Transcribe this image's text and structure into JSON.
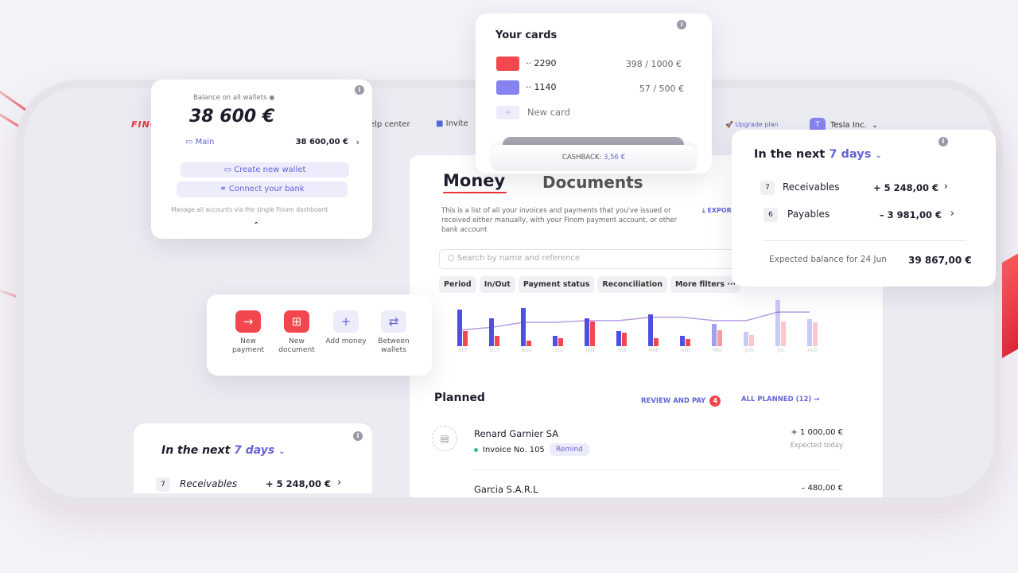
{
  "nav": {
    "logo": "FINOM",
    "help": "elp center",
    "invite": "Invite",
    "upgrade": "Upgrade plan",
    "company_initial": "T",
    "company": "Tesla Inc."
  },
  "balance": {
    "label": "Balance on all wallets",
    "amount": "38 600 €",
    "wallet_name": "Main",
    "wallet_amount": "38 600,00 €",
    "create_wallet": "Create new wallet",
    "connect_bank": "Connect your bank",
    "note": "Manage all accounts via the single Finom dashboard"
  },
  "cards": {
    "title": "Your cards",
    "items": [
      {
        "number": "·· 2290",
        "limit": "398 / 1000 €",
        "color": "#f2474f"
      },
      {
        "number": "·· 1140",
        "limit": "57 / 500 €",
        "color": "#8583f0"
      }
    ],
    "new_card": "New card",
    "cashback_label": "CASHBACK:",
    "cashback_value": "3,56 €"
  },
  "main": {
    "tab_money": "Money",
    "tab_documents": "Documents",
    "description": "This is a list of all your invoices and payments that you've issued or received either manually, with your Finom payment account, or other bank account",
    "export": "EXPOR",
    "search_placeholder": "Search by name and reference",
    "filters": [
      "Period",
      "In/Out",
      "Payment status",
      "Reconciliation",
      "More filters ···"
    ]
  },
  "chart_data": {
    "type": "bar",
    "categories": [
      "SEP",
      "OCT",
      "NOV",
      "DEC",
      "JAN",
      "FEB",
      "MAR",
      "APR",
      "MAY",
      "JUN",
      "JUL",
      "AUG"
    ],
    "series": [
      {
        "values": [
          43,
          33,
          45,
          12,
          33,
          18,
          37,
          12,
          26,
          17,
          54,
          32
        ]
      },
      {
        "values": [
          18,
          12,
          7,
          9,
          29,
          16,
          9,
          8,
          19,
          13,
          29,
          28
        ]
      }
    ],
    "line": [
      19,
      22,
      28,
      28,
      30,
      30,
      34,
      34,
      30,
      30,
      40,
      40
    ],
    "projected_from": "MAY",
    "colors": {
      "in": "#5050e0",
      "out": "#f2474f",
      "line": "#b79fe0"
    }
  },
  "planned": {
    "title": "Planned",
    "review": "REVIEW AND PAY",
    "review_count": "4",
    "all": "ALL PLANNED (12)",
    "items": [
      {
        "name": "Renard Garnier SA",
        "ref": "Invoice No. 105",
        "action": "Remind",
        "amount": "+ 1 000,00 €",
        "status": "Expected today"
      },
      {
        "name": "Garcia S.A.R.L",
        "amount": "– 480,00 €"
      }
    ]
  },
  "next": {
    "prefix": "In the next",
    "period": "7 days",
    "receivables_count": "7",
    "receivables": "Receivables",
    "receivables_amount": "+ 5 248,00 €",
    "payables_count": "6",
    "payables": "Payables",
    "payables_amount": "– 3 981,00 €",
    "expected_label": "Expected balance for 24 Jun",
    "expected_amount": "39 867,00 €"
  },
  "actions": [
    {
      "label": "New payment",
      "icon": "arrow-right"
    },
    {
      "label": "New document",
      "icon": "document-plus"
    },
    {
      "label": "Add money",
      "icon": "plus"
    },
    {
      "label": "Between wallets",
      "icon": "transfer"
    }
  ]
}
